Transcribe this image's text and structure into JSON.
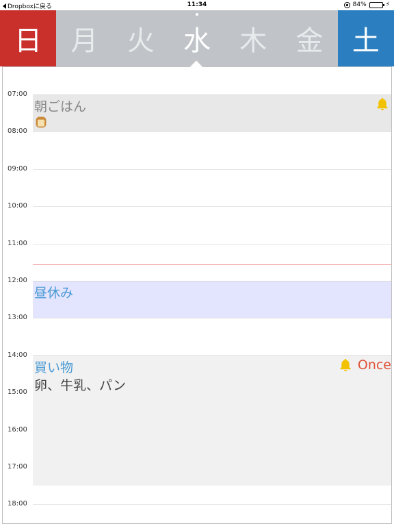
{
  "statusbar": {
    "back_label": "Dropboxに戻る",
    "time": "11:34",
    "battery": "84%",
    "battery_level": 0.84
  },
  "days": [
    {
      "label": "日",
      "kind": "sun"
    },
    {
      "label": "月",
      "kind": "weekday"
    },
    {
      "label": "火",
      "kind": "weekday"
    },
    {
      "label": "水",
      "kind": "active"
    },
    {
      "label": "木",
      "kind": "weekday"
    },
    {
      "label": "金",
      "kind": "weekday"
    },
    {
      "label": "土",
      "kind": "sat"
    }
  ],
  "hours": [
    "07:00",
    "08:00",
    "09:00",
    "10:00",
    "11:00",
    "12:00",
    "13:00",
    "14:00",
    "15:00",
    "16:00",
    "17:00",
    "18:00"
  ],
  "now": "11:34",
  "events": [
    {
      "title": "朝ごはん",
      "start": "07:00",
      "end": "08:00",
      "bg": "#e8e8e8",
      "title_color": "#888888",
      "bell": true,
      "bread": true
    },
    {
      "title": "昼休み",
      "start": "12:00",
      "end": "13:00",
      "bg": "#e3e4fd",
      "title_color": "#4a9ad4",
      "bell": false
    },
    {
      "title": "買い物",
      "note": "卵、牛乳、パン",
      "start": "14:00",
      "end": "17:30",
      "bg": "#f1f1f1",
      "title_color": "#4a9ad4",
      "bell": true,
      "once": "Once"
    }
  ],
  "colors": {
    "sunday": "#c9302c",
    "saturday": "#2b7fc1",
    "header_bg": "#c0c4c8",
    "bell": "#f2c200",
    "now_line": "#f0a0a0"
  },
  "icons": [
    "back-arrow-icon",
    "orientation-lock-icon",
    "battery-icon",
    "charging-icon",
    "bell-icon",
    "bread-icon"
  ]
}
